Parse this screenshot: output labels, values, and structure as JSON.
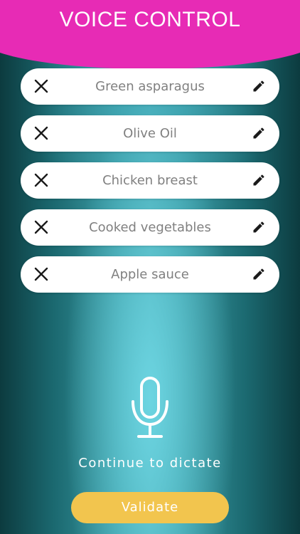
{
  "header": {
    "title": "VOICE CONTROL",
    "color": "#e72bb5"
  },
  "items": [
    {
      "label": "Green asparagus",
      "remove_icon": "close-icon",
      "edit_icon": "pencil-icon"
    },
    {
      "label": "Olive Oil",
      "remove_icon": "close-icon",
      "edit_icon": "pencil-icon"
    },
    {
      "label": "Chicken breast",
      "remove_icon": "close-icon",
      "edit_icon": "pencil-icon"
    },
    {
      "label": "Cooked vegetables",
      "remove_icon": "close-icon",
      "edit_icon": "pencil-icon"
    },
    {
      "label": "Apple sauce",
      "remove_icon": "close-icon",
      "edit_icon": "pencil-icon"
    }
  ],
  "dictation": {
    "icon": "microphone-icon",
    "label": "Continue to dictate"
  },
  "actions": {
    "validate_label": "Validate",
    "validate_color": "#f2c54e"
  }
}
